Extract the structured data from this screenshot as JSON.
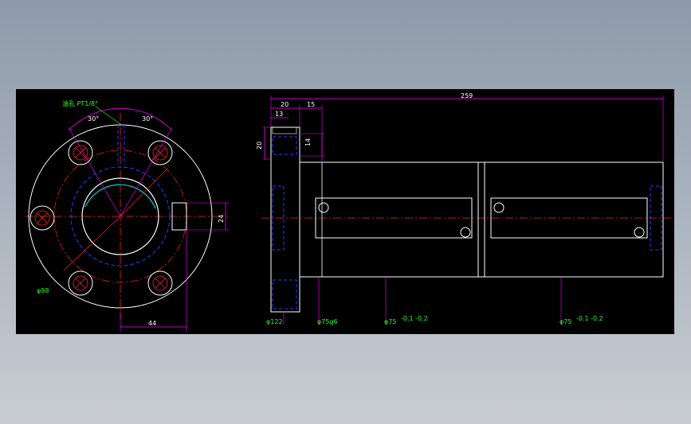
{
  "colors": {
    "background": "#000000",
    "outline": "#ffffff",
    "centerline": "#ff2020",
    "dimension": "#ff00ff",
    "hidden": "#2a3cff",
    "annotation": "#22ff22",
    "thread": "#00d0d0"
  },
  "front_view": {
    "angle_left": "30°",
    "angle_right": "30°",
    "port_note": "油孔 PT1/8\"",
    "bolt_circle": "φ98",
    "offset_horizontal": "44",
    "port_height": "24"
  },
  "side_view": {
    "overall_length": "259",
    "flange_width": "20",
    "spacer_width": "15",
    "flange_step": "13",
    "flange_height": "20",
    "hole_depth": "14",
    "flange_diameter": "φ122",
    "pilot_diameter": "φ75g6",
    "body_diameter_1": "φ75",
    "body_tol_1": "-0.1 -0.2",
    "body_diameter_2": "φ75",
    "body_tol_2": "-0.1 -0.2"
  }
}
